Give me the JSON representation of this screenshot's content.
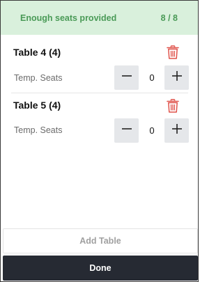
{
  "status": {
    "message": "Enough seats provided",
    "count": "8 / 8",
    "color": "#4a9a57",
    "background": "#d9f0dc"
  },
  "tables": [
    {
      "name": "Table 4 (4)",
      "seat_label": "Temp. Seats",
      "temp_seats": "0",
      "delete_icon": "trash-icon"
    },
    {
      "name": "Table 5 (4)",
      "seat_label": "Temp. Seats",
      "temp_seats": "0",
      "delete_icon": "trash-icon"
    }
  ],
  "stepper": {
    "decrement_icon": "minus-icon",
    "increment_icon": "plus-icon"
  },
  "actions": {
    "add_table_label": "Add Table",
    "done_label": "Done"
  },
  "colors": {
    "danger": "#e0524a",
    "primary_dark": "#262a33",
    "stepper_bg": "#e5e7ea"
  }
}
